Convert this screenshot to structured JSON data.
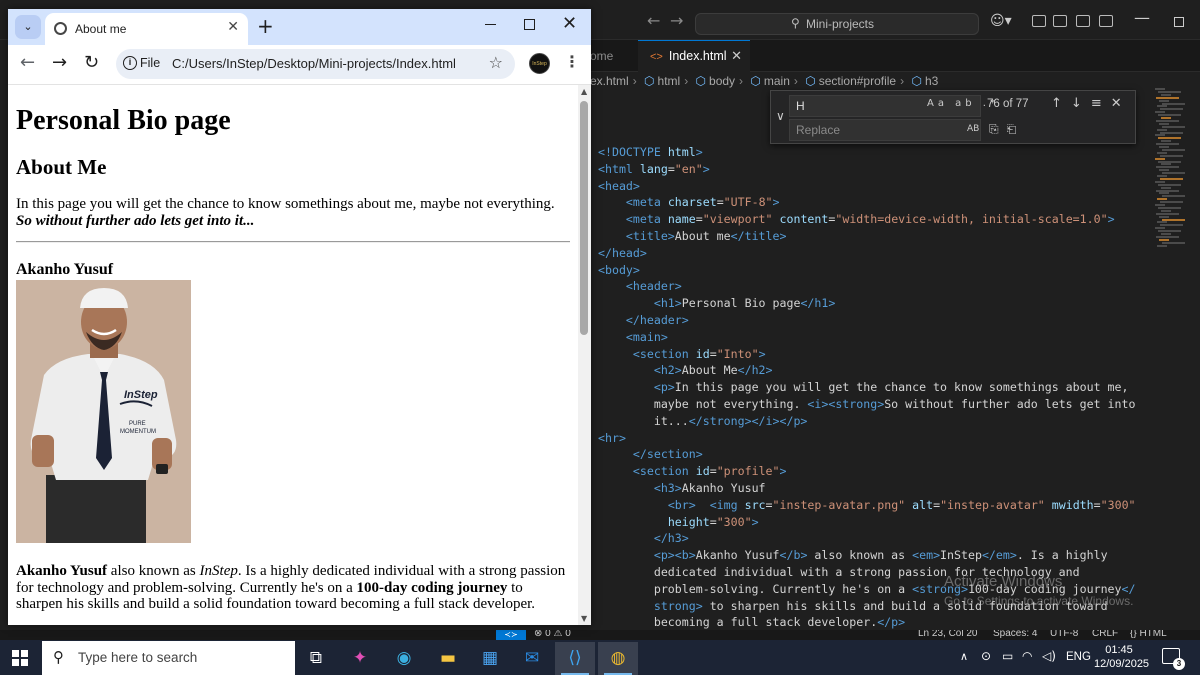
{
  "colors": {
    "vscode_bg": "#1f1f1f",
    "chrome_tabstrip": "#d3e3fd",
    "taskbar": "#1c2435",
    "vscode_accent": "#0078d4",
    "html_tag": "#569cd6",
    "html_attr": "#9cdcfe",
    "html_string": "#ce9178"
  },
  "vscode": {
    "search_text": "Mini-projects",
    "tabs": [
      {
        "label": "ome",
        "active": false
      },
      {
        "label": "Index.html",
        "active": true,
        "icon": "html-file-icon"
      }
    ],
    "breadcrumb": [
      "ex.html",
      "html",
      "body",
      "main",
      "section#profile",
      "h3"
    ],
    "find": {
      "value": "H",
      "count": "76 of 77",
      "replace_placeholder": "Replace",
      "options": "Aa ab .*",
      "replace_option": "AB"
    },
    "code_lines": [
      [
        [
          "d",
          "<!DOCTYPE "
        ],
        [
          "a",
          "html"
        ],
        [
          "d",
          ">"
        ]
      ],
      [
        [
          "t",
          "<html "
        ],
        [
          "a",
          "lang"
        ],
        [
          "x",
          "="
        ],
        [
          "s",
          "\"en\""
        ],
        [
          "t",
          ">"
        ]
      ],
      [
        [
          "t",
          "<head>"
        ]
      ],
      [
        [
          "x",
          "    "
        ],
        [
          "t",
          "<meta "
        ],
        [
          "a",
          "charset"
        ],
        [
          "x",
          "="
        ],
        [
          "s",
          "\"UTF-8\""
        ],
        [
          "t",
          ">"
        ]
      ],
      [
        [
          "x",
          "    "
        ],
        [
          "t",
          "<meta "
        ],
        [
          "a",
          "name"
        ],
        [
          "x",
          "="
        ],
        [
          "s",
          "\"viewport\" "
        ],
        [
          "a",
          "content"
        ],
        [
          "x",
          "="
        ],
        [
          "s",
          "\"width=device-width, initial-scale=1.0\""
        ],
        [
          "t",
          ">"
        ]
      ],
      [
        [
          "x",
          "    "
        ],
        [
          "t",
          "<title>"
        ],
        [
          "x",
          "About me"
        ],
        [
          "t",
          "</title>"
        ]
      ],
      [
        [
          "t",
          "</head>"
        ]
      ],
      [
        [
          "t",
          "<body>"
        ]
      ],
      [
        [
          "x",
          "    "
        ],
        [
          "t",
          "<header>"
        ]
      ],
      [
        [
          "x",
          "        "
        ],
        [
          "t",
          "<h1>"
        ],
        [
          "x",
          "Personal Bio page"
        ],
        [
          "t",
          "</h1>"
        ]
      ],
      [
        [
          "x",
          "    "
        ],
        [
          "t",
          "</header>"
        ]
      ],
      [
        [
          "x",
          "    "
        ],
        [
          "t",
          "<main>"
        ]
      ],
      [
        [
          "x",
          "     "
        ],
        [
          "t",
          "<section "
        ],
        [
          "a",
          "id"
        ],
        [
          "x",
          "="
        ],
        [
          "s",
          "\"Into\""
        ],
        [
          "t",
          ">"
        ]
      ],
      [
        [
          "x",
          "        "
        ],
        [
          "t",
          "<h2>"
        ],
        [
          "x",
          "About Me"
        ],
        [
          "t",
          "</h2>"
        ]
      ],
      [
        [
          "x",
          "        "
        ],
        [
          "t",
          "<p>"
        ],
        [
          "x",
          "In this page you will get the chance to know somethings about me,"
        ]
      ],
      [
        [
          "x",
          "        maybe not everything. "
        ],
        [
          "t",
          "<i><strong>"
        ],
        [
          "x",
          "So without further ado lets get into"
        ]
      ],
      [
        [
          "x",
          "        it..."
        ],
        [
          "t",
          "</strong></i></p>"
        ]
      ],
      [
        [
          "t",
          "<hr>"
        ]
      ],
      [
        [
          "x",
          "     "
        ],
        [
          "t",
          "</section>"
        ]
      ],
      [
        [
          "x",
          "     "
        ],
        [
          "t",
          "<section "
        ],
        [
          "a",
          "id"
        ],
        [
          "x",
          "="
        ],
        [
          "s",
          "\"profile\""
        ],
        [
          "t",
          ">"
        ]
      ],
      [
        [
          "x",
          "        "
        ],
        [
          "t",
          "<h3>"
        ],
        [
          "x",
          "Akanho Yusuf"
        ]
      ],
      [
        [
          "x",
          "          "
        ],
        [
          "t",
          "<br>  <img "
        ],
        [
          "a",
          "src"
        ],
        [
          "x",
          "="
        ],
        [
          "s",
          "\"instep-avatar.png\" "
        ],
        [
          "a",
          "alt"
        ],
        [
          "x",
          "="
        ],
        [
          "s",
          "\"instep-avatar\" "
        ],
        [
          "a",
          "mwidth"
        ],
        [
          "x",
          "="
        ],
        [
          "s",
          "\"300\""
        ]
      ],
      [
        [
          "x",
          "          "
        ],
        [
          "a",
          "height"
        ],
        [
          "x",
          "="
        ],
        [
          "s",
          "\"300\""
        ],
        [
          "t",
          ">"
        ]
      ],
      [
        [
          "x",
          "        "
        ],
        [
          "t",
          "</h3>"
        ]
      ],
      [
        [
          "x",
          "        "
        ],
        [
          "t",
          "<p><b>"
        ],
        [
          "x",
          "Akanho Yusuf"
        ],
        [
          "t",
          "</b>"
        ],
        [
          "x",
          " also known as "
        ],
        [
          "t",
          "<em>"
        ],
        [
          "x",
          "InStep"
        ],
        [
          "t",
          "</em>"
        ],
        [
          "x",
          ". Is a highly"
        ]
      ],
      [
        [
          "x",
          "        dedicated individual with a strong passion for technology and"
        ]
      ],
      [
        [
          "x",
          "        problem-solving. Currently he's on a "
        ],
        [
          "t",
          "<strong>"
        ],
        [
          "x",
          "100-day coding journey"
        ],
        [
          "t",
          "</"
        ]
      ],
      [
        [
          "x",
          "        "
        ],
        [
          "t",
          "strong>"
        ],
        [
          "x",
          " to sharpen his skills and build a solid foundation toward"
        ]
      ],
      [
        [
          "x",
          "        becoming a full stack developer."
        ],
        [
          "t",
          "</p>"
        ]
      ]
    ],
    "watermark_title": "Activate Windows",
    "watermark_sub": "Go to Settings to activate Windows.",
    "status": {
      "problems": "⊗ 0 ⚠ 0",
      "position": "Ln 23, Col 20",
      "spaces": "Spaces: 4",
      "encoding": "UTF-8",
      "eol": "CRLF",
      "language": "{} HTML"
    }
  },
  "chrome": {
    "tab_title": "About me",
    "file_chip": "File",
    "url": "C:/Users/InStep/Desktop/Mini-projects/Index.html",
    "profile_label": "InStep"
  },
  "page": {
    "h1": "Personal Bio page",
    "h2": "About Me",
    "intro_text": "In this page you will get the chance to know somethings about me, maybe not everything.",
    "intro_emphasis": "So without further ado lets get into it...",
    "h3": "Akanho Yusuf",
    "avatar_alt": "instep-avatar",
    "avatar_shirt_brand": "InStep",
    "avatar_shirt_line1": "PURE",
    "avatar_shirt_line2": "MOMENTUM",
    "bio": {
      "name": "Akanho Yusuf",
      "t1": " also known as ",
      "alias": "InStep",
      "t2": ". Is a highly dedicated individual with a strong passion for technology and problem-solving. Currently he's on a ",
      "journey": "100-day coding journey",
      "t3": " to sharpen his skills and build a solid foundation toward becoming a full stack developer."
    }
  },
  "taskbar": {
    "search_placeholder": "Type here to search",
    "apps": [
      "task-view-icon",
      "copilot-icon",
      "edge-icon",
      "file-explorer-icon",
      "microsoft-store-icon",
      "outlook-icon",
      "vscode-icon",
      "chrome-icon"
    ],
    "language": "ENG",
    "time": "01:45",
    "date": "12/09/2025",
    "notification_count": "3"
  }
}
